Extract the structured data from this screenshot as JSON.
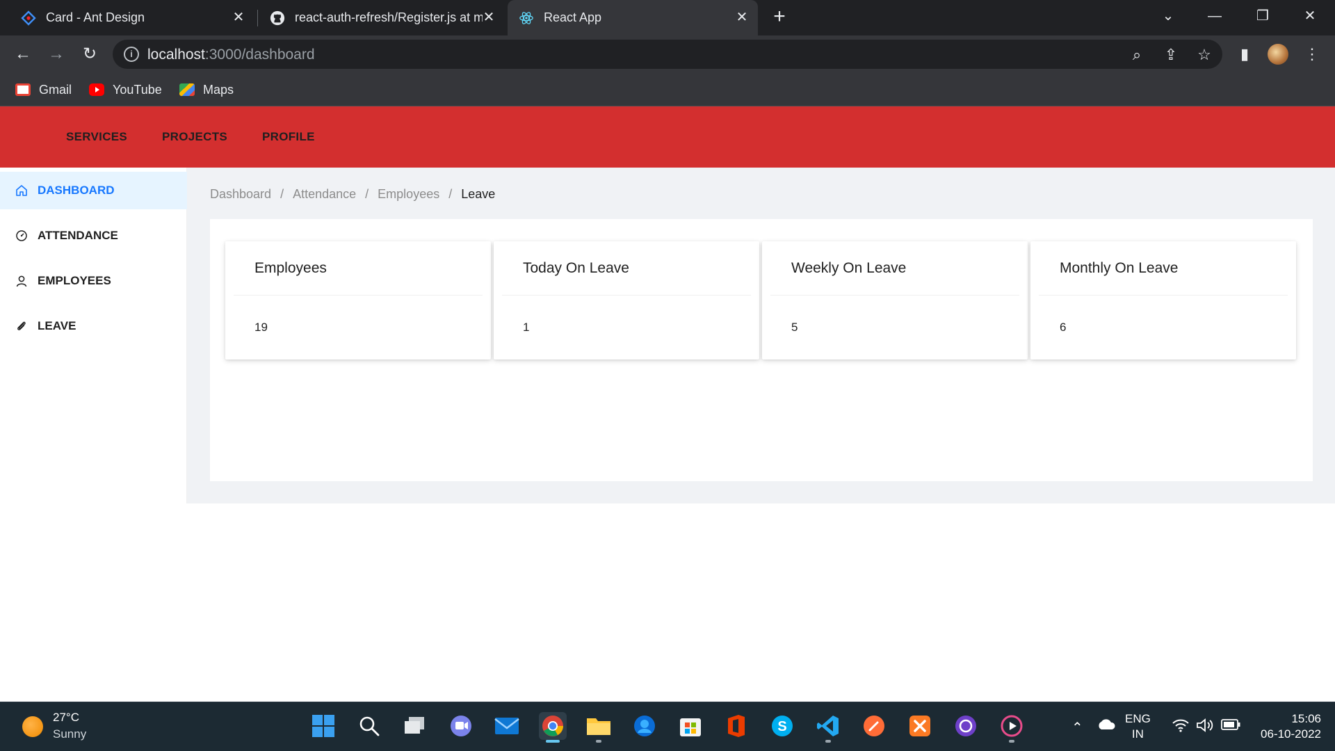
{
  "browser": {
    "tabs": [
      {
        "title": "Card - Ant Design",
        "icon": "ant-design-logo-icon"
      },
      {
        "title": "react-auth-refresh/Register.js at m",
        "icon": "github-logo-icon"
      },
      {
        "title": "React App",
        "icon": "react-logo-icon",
        "active": true
      }
    ],
    "new_tab_label": "+",
    "address": {
      "host": "localhost",
      "path": ":3000/dashboard"
    },
    "bookmarks": [
      {
        "label": "Gmail",
        "icon": "gmail-icon"
      },
      {
        "label": "YouTube",
        "icon": "youtube-icon"
      },
      {
        "label": "Maps",
        "icon": "maps-icon"
      }
    ]
  },
  "app": {
    "topnav": [
      "SERVICES",
      "PROJECTS",
      "PROFILE"
    ],
    "accent": "#d32f2f",
    "sidebar": [
      {
        "label": "DASHBOARD",
        "icon": "home-icon",
        "active": true
      },
      {
        "label": "ATTENDANCE",
        "icon": "dashboard-gauge-icon"
      },
      {
        "label": "EMPLOYEES",
        "icon": "user-icon"
      },
      {
        "label": "LEAVE",
        "icon": "paperclip-icon"
      }
    ],
    "breadcrumb": [
      "Dashboard",
      "Attendance",
      "Employees",
      "Leave"
    ],
    "cards": [
      {
        "title": "Employees",
        "value": "19"
      },
      {
        "title": "Today On Leave",
        "value": "1"
      },
      {
        "title": "Weekly On Leave",
        "value": "5"
      },
      {
        "title": "Monthly On Leave",
        "value": "6"
      }
    ]
  },
  "taskbar": {
    "weather": {
      "temp": "27°C",
      "condition": "Sunny"
    },
    "language": {
      "line1": "ENG",
      "line2": "IN"
    },
    "clock": {
      "time": "15:06",
      "date": "06-10-2022"
    },
    "apps": [
      "windows-start-icon",
      "search-icon",
      "task-view-icon",
      "teams-chat-icon",
      "mail-icon",
      "chrome-icon",
      "file-explorer-icon",
      "microsoft-store-icon",
      "ms-store-bag-icon",
      "office-icon",
      "skype-icon",
      "vscode-icon",
      "postman-icon",
      "xampp-icon",
      "github-desktop-icon",
      "media-player-icon"
    ]
  }
}
